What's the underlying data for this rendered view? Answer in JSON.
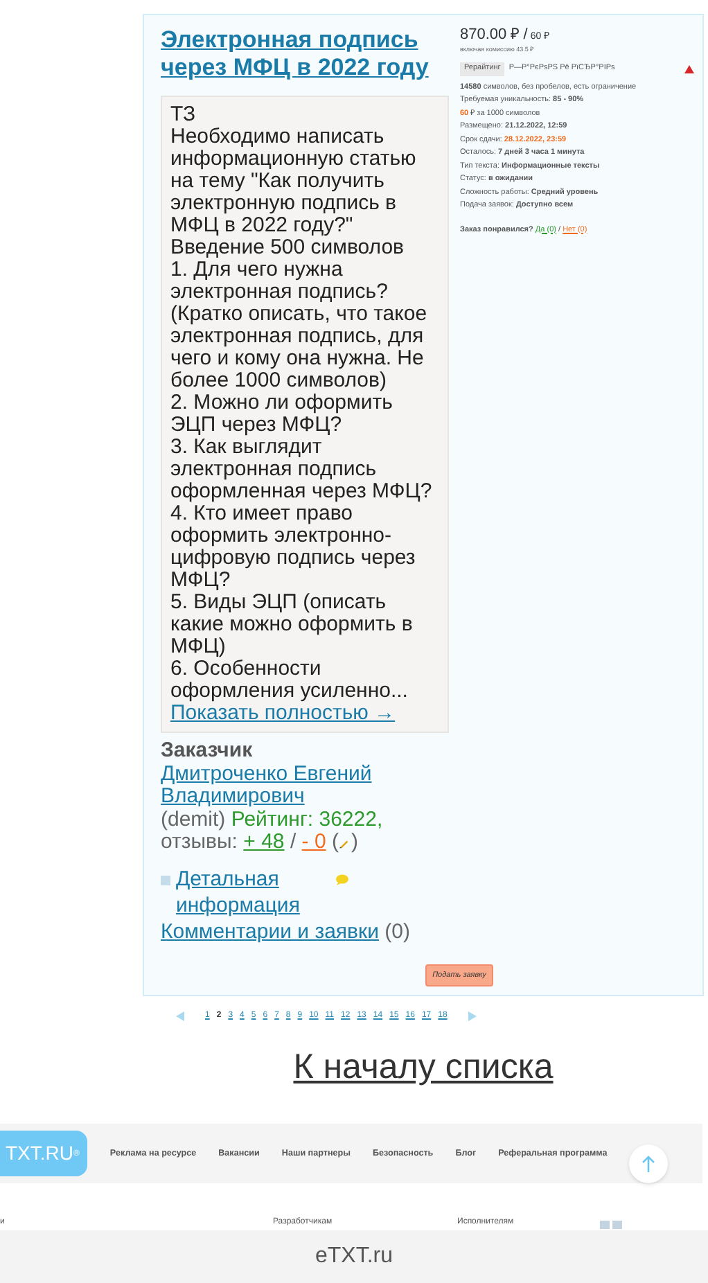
{
  "order": {
    "title": "Электронная подпись через МФЦ в 2022 году",
    "task": [
      "ТЗ",
      "Необходимо написать информационную статью на тему \"Как получить электронную подпись в МФЦ в 2022 году?\"",
      "Введение 500 символов",
      "1. Для чего нужна электронная подпись? (Кратко описать, что такое электронная подпись, для чего и кому она нужна. Не более 1000 символов)",
      "2. Можно ли оформить ЭЦП через МФЦ?",
      "3. Как выглядит электронная подпись оформленная через МФЦ?",
      "4. Кто имеет право оформить электронно-цифровую подпись через МФЦ?",
      "5. Виды ЭЦП (описать какие можно оформить в МФЦ)",
      "6. Особенности оформления усиленно..."
    ],
    "show_more": "Показать полностью →",
    "customer": {
      "label": "Заказчик",
      "name": "Дмитроченко Евгений Владимирович",
      "login": "(demit)",
      "rating": "Рейтинг: 36222,",
      "reviews_label": "отзывы:",
      "positive": "+ 48",
      "separator": "/",
      "negative": "- 0",
      "paren_open": "(",
      "paren_close": ")"
    },
    "details_link": "Детальная информация",
    "comments_link": "Комментарии и заявки",
    "comments_count": "(0)",
    "apply_button": "Подать заявку",
    "price": "870.00 ₽ /",
    "price_per": "60 ₽",
    "commission": "включая комиссию 43.5 ₽",
    "type_badge": "Рерайтинг",
    "category": "Р—Р°РєРѕРЅ Рё РїСЂР°РІРѕ",
    "details": [
      {
        "kind": "plain",
        "text": "**14580** символов, без пробелов, есть ограничение"
      },
      {
        "kind": "plain",
        "text": "Требуемая уникальность: **85 - 90%**"
      },
      {
        "kind": "accent",
        "value": "60",
        "text": "₽ за 1000 символов"
      },
      {
        "kind": "plain",
        "text": "Размещено: **21.12.2022, 12:59**"
      },
      {
        "kind": "deadline",
        "label": "Срок сдачи:",
        "value": "28.12.2022, 23:59"
      },
      {
        "kind": "plain",
        "text": "Осталось: **7 дней 3 часа 1 минута**"
      },
      {
        "kind": "plain",
        "text": "Тип текста: **Информационные тексты**"
      },
      {
        "kind": "plain",
        "text": "Статус: **в ожидании**"
      },
      {
        "kind": "plain",
        "text": "Сложность работы: **Средний уровень**"
      },
      {
        "kind": "plain",
        "text": "Подача заявок: **Доступно всем**"
      }
    ],
    "like_question": "Заказ понравился?",
    "like_yes": "Да (0)",
    "like_sep": "/",
    "like_no": "Нет (0)"
  },
  "pagination": {
    "pages": [
      {
        "label": "1",
        "selected": false
      },
      {
        "label": "2",
        "selected": true
      },
      {
        "label": "3",
        "selected": false
      },
      {
        "label": "4",
        "selected": false
      },
      {
        "label": "5",
        "selected": false
      },
      {
        "label": "6",
        "selected": false
      },
      {
        "label": "7",
        "selected": false
      },
      {
        "label": "8",
        "selected": false
      },
      {
        "label": "9",
        "selected": false
      },
      {
        "label": "10",
        "selected": false
      },
      {
        "label": "11",
        "selected": false
      },
      {
        "label": "12",
        "selected": false
      },
      {
        "label": "13",
        "selected": false
      },
      {
        "label": "14",
        "selected": false
      },
      {
        "label": "15",
        "selected": false
      },
      {
        "label": "16",
        "selected": false
      },
      {
        "label": "17",
        "selected": false
      },
      {
        "label": "18",
        "selected": false
      }
    ]
  },
  "back_to_top_link": "К началу списка",
  "footer": {
    "logo": "TXT.RU",
    "logo_mark": "®",
    "nav": [
      "Реклама на ресурсе",
      "Вакансии",
      "Наши партнеры",
      "Безопасность",
      "Блог",
      "Реферальная программа"
    ],
    "columns": [
      "и",
      "Разработчикам",
      "Исполнителям"
    ]
  },
  "bottom_bar": {
    "title": "eTXT.ru"
  }
}
